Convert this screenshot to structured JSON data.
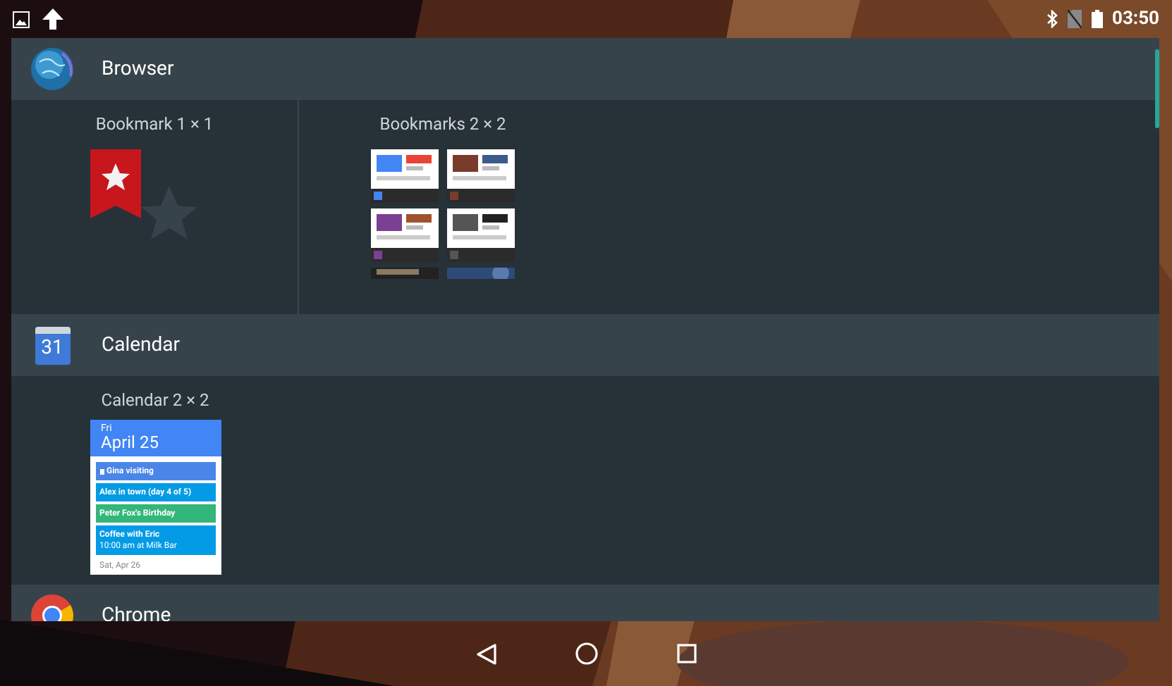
{
  "status_bar": {
    "time": "03:50"
  },
  "apps": [
    {
      "name": "Browser",
      "widgets": [
        {
          "label": "Bookmark 1 × 1",
          "kind": "bookmark"
        },
        {
          "label": "Bookmarks 2 × 2",
          "kind": "bookmarks"
        }
      ]
    },
    {
      "name": "Calendar",
      "icon_text": "31",
      "widgets": [
        {
          "label": "Calendar 2 × 2",
          "kind": "calendar",
          "day": "Fri",
          "date": "April 25",
          "events": [
            {
              "title": "Gina visiting",
              "color": "#4a86e8",
              "locked": true
            },
            {
              "title": "Alex in town (day 4 of 5)",
              "color": "#039be5",
              "locked": false
            },
            {
              "title": "Peter Fox's Birthday",
              "color": "#33b679",
              "locked": false
            },
            {
              "title": "Coffee with Eric",
              "detail": "10:00 am at Milk Bar",
              "color": "#039be5",
              "locked": false
            }
          ],
          "next_day": "Sat, Apr 26"
        }
      ]
    },
    {
      "name": "Chrome"
    }
  ]
}
